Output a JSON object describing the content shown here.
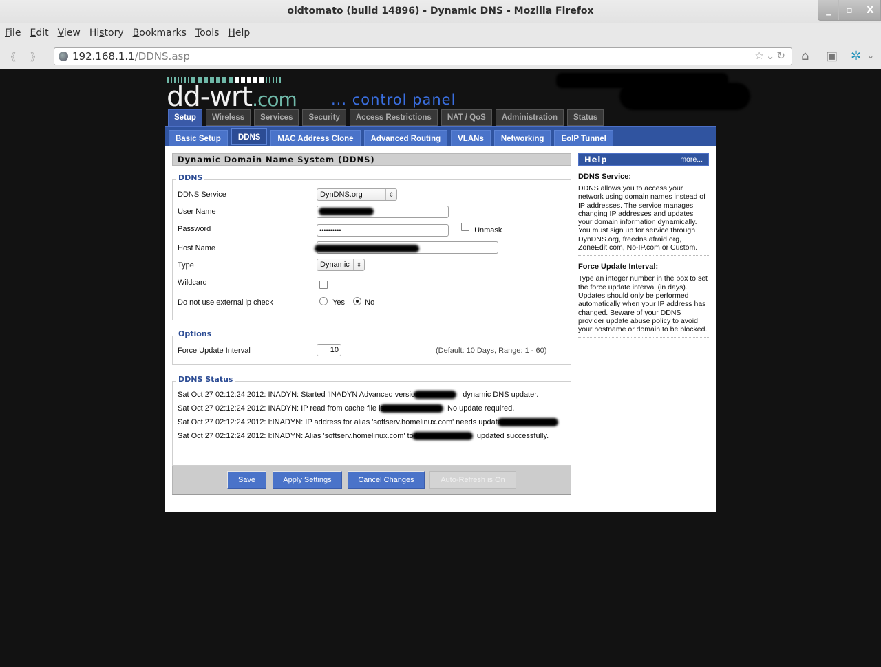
{
  "window": {
    "title": "oldtomato (build 14896) - Dynamic DNS - Mozilla Firefox",
    "controls": [
      "_",
      "▫",
      "X"
    ]
  },
  "menubar": {
    "items": [
      {
        "label": "File",
        "key": "F",
        "rest": "ile"
      },
      {
        "label": "Edit",
        "key": "E",
        "rest": "dit"
      },
      {
        "label": "View",
        "key": "V",
        "rest": "iew"
      },
      {
        "label": "History",
        "pre": "Hi",
        "key": "s",
        "rest": "tory"
      },
      {
        "label": "Bookmarks",
        "key": "B",
        "rest": "ookmarks"
      },
      {
        "label": "Tools",
        "key": "T",
        "rest": "ools"
      },
      {
        "label": "Help",
        "key": "H",
        "rest": "elp"
      }
    ]
  },
  "navbar": {
    "url_host": "192.168.1.1",
    "url_path": "/DDNS.asp",
    "icons": [
      "back-icon",
      "forward-icon",
      "globe-icon",
      "bookmark-star-icon",
      "dropdown-icon",
      "reload-icon",
      "home-icon",
      "print-icon",
      "addon-icon"
    ]
  },
  "header": {
    "logo_main": "dd-wrt",
    "logo_suffix": ".com",
    "subtitle": "... control panel"
  },
  "main_tabs": [
    {
      "label": "Setup",
      "active": true
    },
    {
      "label": "Wireless",
      "active": false
    },
    {
      "label": "Services",
      "active": false
    },
    {
      "label": "Security",
      "active": false
    },
    {
      "label": "Access Restrictions",
      "active": false
    },
    {
      "label": "NAT / QoS",
      "active": false
    },
    {
      "label": "Administration",
      "active": false
    },
    {
      "label": "Status",
      "active": false
    }
  ],
  "sub_tabs": [
    {
      "label": "Basic Setup",
      "active": false
    },
    {
      "label": "DDNS",
      "active": true
    },
    {
      "label": "MAC Address Clone",
      "active": false
    },
    {
      "label": "Advanced Routing",
      "active": false
    },
    {
      "label": "VLANs",
      "active": false
    },
    {
      "label": "Networking",
      "active": false
    },
    {
      "label": "EoIP Tunnel",
      "active": false
    }
  ],
  "page_title": "Dynamic Domain Name System (DDNS)",
  "ddns": {
    "legend": "DDNS",
    "service_label": "DDNS Service",
    "service_value": "DynDNS.org",
    "username_label": "User Name",
    "password_label": "Password",
    "password_value": "••••••••••",
    "unmask_label": "Unmask",
    "hostname_label": "Host Name",
    "type_label": "Type",
    "type_value": "Dynamic",
    "wildcard_label": "Wildcard",
    "extip_label": "Do not use external ip check",
    "extip_yes": "Yes",
    "extip_no": "No",
    "extip_selected": "No"
  },
  "options": {
    "legend": "Options",
    "interval_label": "Force Update Interval",
    "interval_value": "10",
    "interval_hint": "(Default: 10 Days, Range: 1 - 60)"
  },
  "status": {
    "legend": "DDNS Status",
    "lines": [
      {
        "pre": "Sat Oct 27 02:12:24 2012: INADYN: Started 'INADYN Advanced version",
        "post": " dynamic DNS updater."
      },
      {
        "pre": "Sat Oct 27 02:12:24 2012: INADYN: IP read from cache file is",
        "post": "No update required."
      },
      {
        "pre": "Sat Oct 27 02:12:24 2012: I:INADYN: IP address for alias 'softserv.homelinux.com' needs update t",
        "post": ""
      },
      {
        "pre": "Sat Oct 27 02:12:24 2012: I:INADYN: Alias 'softserv.homelinux.com' to I",
        "post": "updated successfully."
      }
    ]
  },
  "buttons": {
    "save": "Save",
    "apply": "Apply Settings",
    "cancel": "Cancel Changes",
    "autorefresh": "Auto-Refresh is On"
  },
  "help": {
    "title": "Help",
    "more": "more...",
    "sections": [
      {
        "title": "DDNS Service:",
        "text": "DDNS allows you to access your network using domain names instead of IP addresses. The service manages changing IP addresses and updates your domain information dynamically. You must sign up for service through DynDNS.org, freedns.afraid.org, ZoneEdit.com, No-IP.com or Custom."
      },
      {
        "title": "Force Update Interval:",
        "text": "Type an integer number in the box to set the force update interval (in days). Updates should only be performed automatically when your IP address has changed. Beware of your DDNS provider update abuse policy to avoid your hostname or domain to be blocked."
      }
    ]
  },
  "colors": {
    "accent_blue": "#3054a0",
    "button_blue": "#4a73c9",
    "logo_teal": "#6fb8a8",
    "subtitle_blue": "#3a6fe0",
    "page_bg": "#121212"
  }
}
